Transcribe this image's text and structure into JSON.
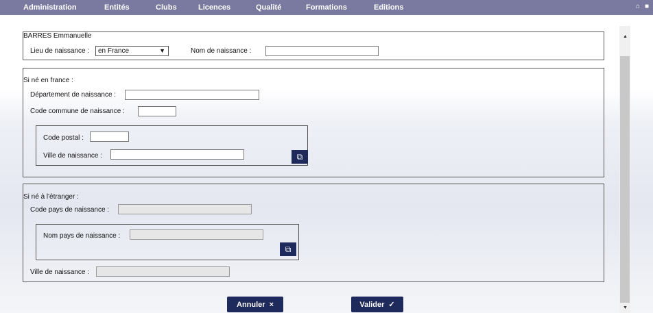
{
  "menu": {
    "items": [
      "Administration",
      "Entités",
      "Clubs",
      "Licences",
      "Qualité",
      "Formations",
      "Editions"
    ],
    "home_icon": "home-icon",
    "lock_icon": "lock-icon"
  },
  "person": {
    "name": "BARRES Emmanuelle",
    "lieu_label": "Lieu de naissance :",
    "lieu_value": "en France",
    "nom_label": "Nom de naissance :",
    "nom_value": ""
  },
  "france": {
    "heading": "Si né en france :",
    "departement_label": "Département de naissance :",
    "code_commune_label": "Code commune de naissance :",
    "code_postal_label": "Code postal :",
    "ville_label": "Ville de naissance :"
  },
  "etranger": {
    "heading": "Si né à l'étranger :",
    "code_pays_label": "Code pays de naissance :",
    "nom_pays_label": "Nom pays de naissance :",
    "ville_label": "Ville de naissance :"
  },
  "buttons": {
    "annuler": "Annuler",
    "annuler_icon": "×",
    "valider": "Valider",
    "valider_icon": "✓"
  },
  "colors": {
    "menubar": "#7a7aa0",
    "button": "#1f2a5c"
  }
}
